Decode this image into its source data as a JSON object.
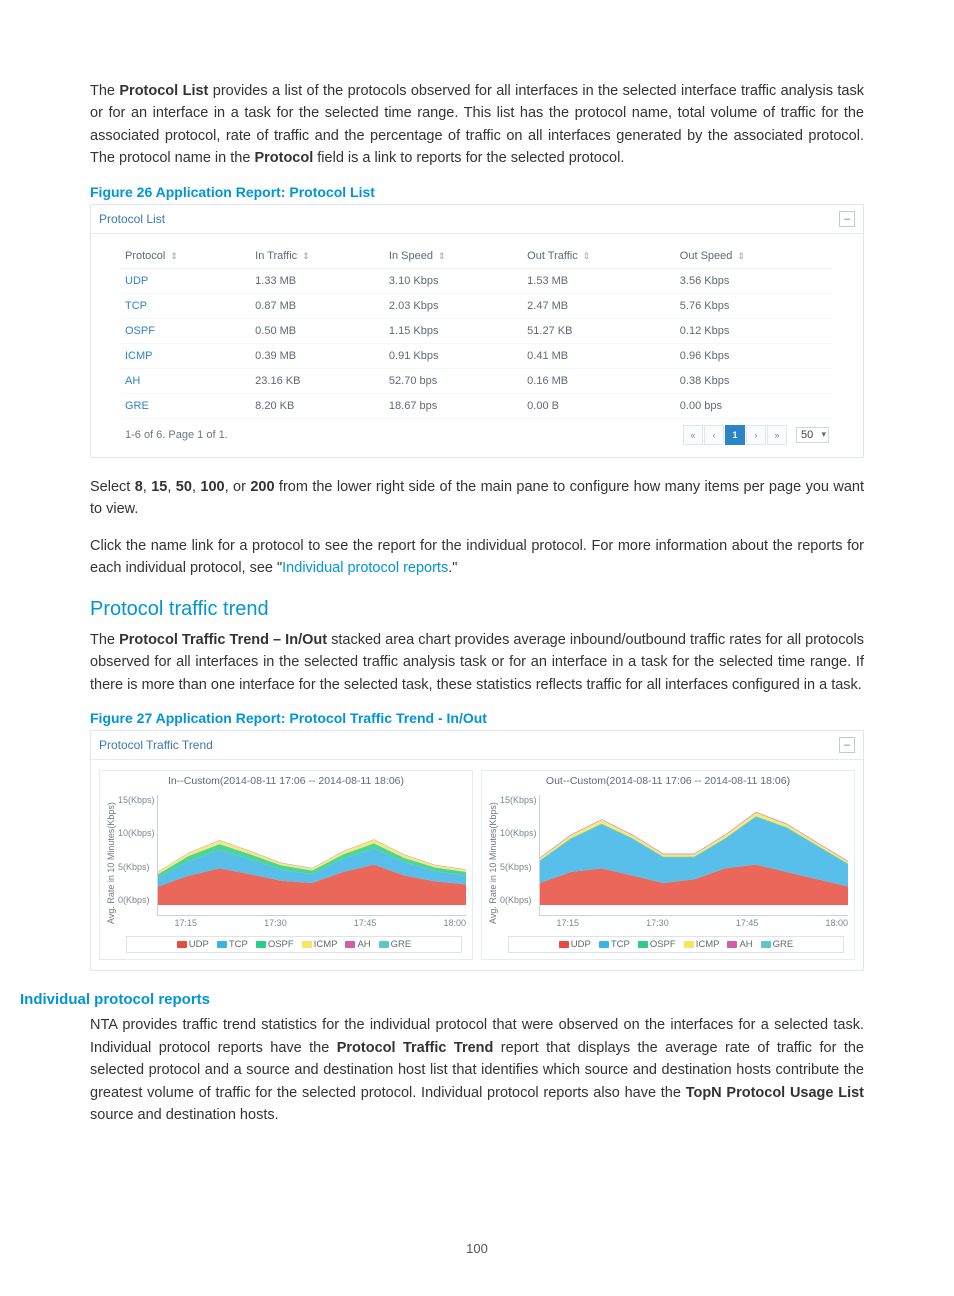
{
  "intro_para": {
    "pre": "The ",
    "bold1": "Protocol List",
    "mid": " provides a list of the protocols observed for all interfaces in the selected interface traffic analysis task or for an interface in a task for the selected time range. This list has the protocol name, total volume of traffic for the associated protocol, rate of traffic and the percentage of traffic on all interfaces generated by the associated protocol. The protocol name in the ",
    "bold2": "Protocol",
    "post": " field is a link to reports for the selected protocol."
  },
  "figure26_caption": "Figure 26 Application Report: Protocol List",
  "protocol_list": {
    "panel_title": "Protocol List",
    "columns": [
      "Protocol",
      "In Traffic",
      "In Speed",
      "Out Traffic",
      "Out Speed"
    ],
    "rows": [
      {
        "protocol": "UDP",
        "in_traffic": "1.33 MB",
        "in_speed": "3.10 Kbps",
        "out_traffic": "1.53 MB",
        "out_speed": "3.56 Kbps"
      },
      {
        "protocol": "TCP",
        "in_traffic": "0.87 MB",
        "in_speed": "2.03 Kbps",
        "out_traffic": "2.47 MB",
        "out_speed": "5.76 Kbps"
      },
      {
        "protocol": "OSPF",
        "in_traffic": "0.50 MB",
        "in_speed": "1.15 Kbps",
        "out_traffic": "51.27 KB",
        "out_speed": "0.12 Kbps"
      },
      {
        "protocol": "ICMP",
        "in_traffic": "0.39 MB",
        "in_speed": "0.91 Kbps",
        "out_traffic": "0.41 MB",
        "out_speed": "0.96 Kbps"
      },
      {
        "protocol": "AH",
        "in_traffic": "23.16 KB",
        "in_speed": "52.70 bps",
        "out_traffic": "0.16 MB",
        "out_speed": "0.38 Kbps"
      },
      {
        "protocol": "GRE",
        "in_traffic": "8.20 KB",
        "in_speed": "18.67 bps",
        "out_traffic": "0.00 B",
        "out_speed": "0.00 bps"
      }
    ],
    "footer_text": "1-6 of 6. Page 1 of 1.",
    "pager": {
      "first": "«",
      "prev": "‹",
      "current": "1",
      "next": "›",
      "last": "»"
    },
    "page_size": "50"
  },
  "select_para": {
    "pre": "Select ",
    "b1": "8",
    "s1": ", ",
    "b2": "15",
    "s2": ", ",
    "b3": "50",
    "s3": ", ",
    "b4": "100",
    "s4": ", or ",
    "b5": "200",
    "post": " from the lower right side of the main pane to configure how many items per page you want to view."
  },
  "click_para": {
    "pre": "Click the name link for a protocol to see the report for the individual protocol. For more information about the reports for each individual protocol, see \"",
    "link": "Individual protocol reports",
    "post": ".\""
  },
  "section_trend_heading": "Protocol traffic trend",
  "trend_para": {
    "pre": "The ",
    "bold": "Protocol Traffic Trend – In/Out",
    "post": " stacked area chart provides average inbound/outbound traffic rates for all protocols observed for all interfaces in the selected traffic analysis task or for an interface in a task for the selected time range. If there is more than one interface for the selected task, these statistics reflects traffic for all interfaces configured in a task."
  },
  "figure27_caption": "Figure 27 Application Report: Protocol Traffic Trend - In/Out",
  "trend_panel": {
    "panel_title": "Protocol Traffic Trend",
    "charts": {
      "in": {
        "title": "In--Custom(2014-08-11 17:06 -- 2014-08-11 18:06)"
      },
      "out": {
        "title": "Out--Custom(2014-08-11 17:06 -- 2014-08-11 18:06)"
      }
    },
    "ylabel": "Avg. Rate in 10 Minutes(Kbps)",
    "yticks": [
      "15(Kbps)",
      "10(Kbps)",
      "5(Kbps)",
      "0(Kbps)"
    ],
    "xticks": [
      "17:15",
      "17:30",
      "17:45",
      "18:00"
    ],
    "legend": [
      "UDP",
      "TCP",
      "OSPF",
      "ICMP",
      "AH",
      "GRE"
    ],
    "colors": {
      "UDP": "#e74c3c",
      "TCP": "#3bb3e6",
      "OSPF": "#2ecc87",
      "ICMP": "#f7e463",
      "AH": "#d05fa6",
      "GRE": "#5ec7c1"
    }
  },
  "chart_data": [
    {
      "type": "area",
      "title": "In--Custom(2014-08-11 17:06 -- 2014-08-11 18:06)",
      "xlabel": "",
      "ylabel": "Avg. Rate in 10 Minutes(Kbps)",
      "ylim": [
        0,
        15
      ],
      "x": [
        "17:10",
        "17:15",
        "17:20",
        "17:25",
        "17:30",
        "17:35",
        "17:40",
        "17:45",
        "17:50",
        "17:55",
        "18:00"
      ],
      "series": [
        {
          "name": "UDP",
          "values": [
            2.5,
            4.0,
            5.0,
            4.2,
            3.3,
            3.0,
            4.5,
            5.5,
            4.0,
            3.2,
            2.8
          ]
        },
        {
          "name": "TCP",
          "values": [
            1.2,
            2.0,
            2.5,
            2.0,
            1.5,
            1.2,
            1.8,
            2.2,
            1.8,
            1.4,
            1.2
          ]
        },
        {
          "name": "OSPF",
          "values": [
            0.5,
            0.7,
            0.8,
            0.7,
            0.6,
            0.5,
            0.6,
            0.7,
            0.6,
            0.5,
            0.5
          ]
        },
        {
          "name": "ICMP",
          "values": [
            0.3,
            0.4,
            0.5,
            0.4,
            0.3,
            0.3,
            0.4,
            0.5,
            0.4,
            0.3,
            0.3
          ]
        },
        {
          "name": "AH",
          "values": [
            0.05,
            0.05,
            0.05,
            0.05,
            0.05,
            0.05,
            0.05,
            0.05,
            0.05,
            0.05,
            0.05
          ]
        },
        {
          "name": "GRE",
          "values": [
            0.02,
            0.02,
            0.02,
            0.02,
            0.02,
            0.02,
            0.02,
            0.02,
            0.02,
            0.02,
            0.02
          ]
        }
      ]
    },
    {
      "type": "area",
      "title": "Out--Custom(2014-08-11 17:06 -- 2014-08-11 18:06)",
      "xlabel": "",
      "ylabel": "Avg. Rate in 10 Minutes(Kbps)",
      "ylim": [
        0,
        15
      ],
      "x": [
        "17:10",
        "17:15",
        "17:20",
        "17:25",
        "17:30",
        "17:35",
        "17:40",
        "17:45",
        "17:50",
        "17:55",
        "18:00"
      ],
      "series": [
        {
          "name": "UDP",
          "values": [
            3.0,
            4.5,
            5.0,
            4.0,
            3.0,
            3.5,
            5.0,
            5.5,
            4.5,
            3.5,
            2.5
          ]
        },
        {
          "name": "TCP",
          "values": [
            3.0,
            4.5,
            6.0,
            5.0,
            3.5,
            3.0,
            4.0,
            6.5,
            6.0,
            4.5,
            3.0
          ]
        },
        {
          "name": "OSPF",
          "values": [
            0.1,
            0.1,
            0.1,
            0.1,
            0.1,
            0.1,
            0.1,
            0.1,
            0.1,
            0.1,
            0.1
          ]
        },
        {
          "name": "ICMP",
          "values": [
            0.3,
            0.4,
            0.5,
            0.4,
            0.3,
            0.3,
            0.4,
            0.5,
            0.4,
            0.3,
            0.3
          ]
        },
        {
          "name": "AH",
          "values": [
            0.1,
            0.1,
            0.1,
            0.1,
            0.1,
            0.1,
            0.1,
            0.1,
            0.1,
            0.1,
            0.1
          ]
        },
        {
          "name": "GRE",
          "values": [
            0,
            0,
            0,
            0,
            0,
            0,
            0,
            0,
            0,
            0,
            0
          ]
        }
      ]
    }
  ],
  "ind_heading": "Individual protocol reports",
  "ind_para": {
    "pre": "NTA provides traffic trend statistics for the individual protocol that were observed on the interfaces for a selected task. Individual protocol reports have the ",
    "bold1": "Protocol Traffic Trend",
    "mid": " report that displays the average rate of traffic for the selected protocol and a source and destination host list that identifies which source and destination hosts contribute the greatest volume of traffic for the selected protocol. Individual protocol reports also have the ",
    "bold2": "TopN Protocol Usage List",
    "post": " source and destination hosts."
  },
  "page_number": "100"
}
